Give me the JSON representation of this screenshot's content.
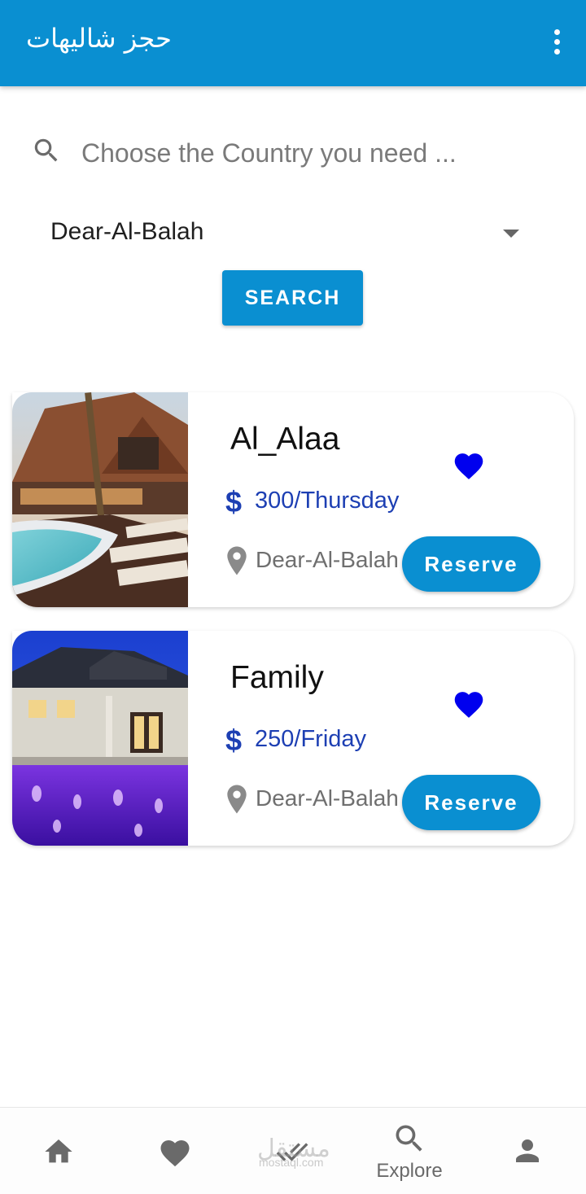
{
  "app_bar": {
    "title": "حجز شاليهات",
    "background": "#0a8fd1"
  },
  "search": {
    "placeholder": "Choose the Country you need ...",
    "value": ""
  },
  "location_select": {
    "selected": "Dear-Al-Balah"
  },
  "search_button": {
    "label": "SEARCH"
  },
  "chalets": [
    {
      "name": "Al_Alaa",
      "price": "300/Thursday",
      "location": "Dear-Al-Balah",
      "favorite": true,
      "reserve_label": "Reserve"
    },
    {
      "name": "Family",
      "price": "250/Friday",
      "location": "Dear-Al-Balah",
      "favorite": true,
      "reserve_label": "Reserve"
    }
  ],
  "bottom_nav": {
    "items": [
      {
        "icon": "home-icon",
        "label": ""
      },
      {
        "icon": "heart-icon",
        "label": ""
      },
      {
        "icon": "double-check-icon",
        "label": ""
      },
      {
        "icon": "search-icon",
        "label": "Explore"
      },
      {
        "icon": "person-icon",
        "label": ""
      }
    ]
  },
  "watermark": {
    "logo_text": "مستقل",
    "url": "mostaql.com"
  },
  "colors": {
    "accent": "#0a8fd1",
    "price": "#1d3fb3",
    "heart": "#0000ee"
  }
}
